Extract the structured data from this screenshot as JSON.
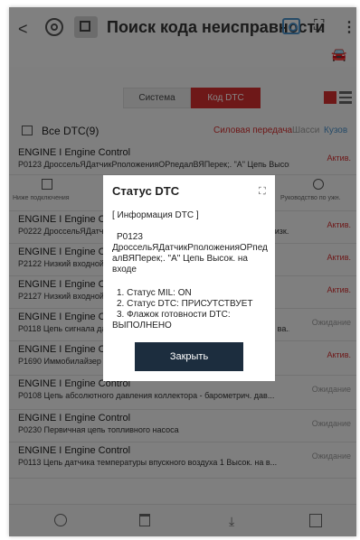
{
  "header": {
    "title": "Поиск кода неисправности",
    "icons": [
      "back-icon",
      "settings-icon",
      "app-icon",
      "camera-icon",
      "expand-icon",
      "more-icon",
      "car-icon"
    ]
  },
  "toggle": {
    "system": "Система",
    "dtc": "Код DTC"
  },
  "filter": {
    "all_label": "Все DTC(9)",
    "categories": [
      "Силовая передача",
      "Шасси",
      "Кузов"
    ]
  },
  "rows": [
    {
      "title": "ENGINE I Engine Control",
      "desc": "P0123 ДроссельЯДатчикРположенияОРпедалВЯПерек;. \"A\" Цепь Высок....",
      "status": "Актив."
    },
    {
      "title": "ENGINE I Engine Control",
      "desc": "P0222 ДроссельЯДатчикРположенияОРпедалВЯПерек;. \"B\" Цепь Низк....",
      "status": "Актив."
    },
    {
      "title": "ENGINE I Engine Control",
      "desc": "P2122 Низкий входной сигнал датчика положения педали",
      "status": "Актив."
    },
    {
      "title": "ENGINE I Engine Control",
      "desc": "P2127 Низкий входной сигнал датчика положения педали",
      "status": "Актив."
    },
    {
      "title": "ENGINE I Engine Control",
      "desc": "P0118 Цепь сигнала датчика температуры охлаждающей жидкости, ва...",
      "status": "Ожидание"
    },
    {
      "title": "ENGINE I Engine Control",
      "desc": "P1690 Иммобилайзер",
      "status": "Актив."
    },
    {
      "title": "ENGINE I Engine Control",
      "desc": "P0108 Цепь абсолютного давления коллектора - барометрич. дав...",
      "status": "Ожидание"
    },
    {
      "title": "ENGINE I Engine Control",
      "desc": "P0230 Первичная цепь топливного насоса",
      "status": "Ожидание"
    },
    {
      "title": "ENGINE I Engine Control",
      "desc": "P0113 Цепь датчика температуры впускного воздуха 1 Высок. на в...",
      "status": "Ожидание"
    }
  ],
  "actions": {
    "share": "Ниже подключения",
    "manual": "Руководство по ужн."
  },
  "modal": {
    "title": "Статус DTC",
    "section": "[ Информация DTC ]",
    "code": "P0123",
    "description": "ДроссельЯДатчикРположенияОРпедалВЯПерек;. \"A\" Цепь Высок. на входе",
    "status_1": "1. Статус MIL: ON",
    "status_2": "2. Статус DTC: ПРИСУТСТВУЕТ",
    "status_3": "3. Флажок готовности DTC:",
    "status_3_value": "ВЫПОЛНЕНО",
    "close": "Закрыть"
  },
  "colors": {
    "accent": "#d32f2f",
    "button_dark": "#1c2d3e",
    "link_blue": "#4a90c8"
  }
}
